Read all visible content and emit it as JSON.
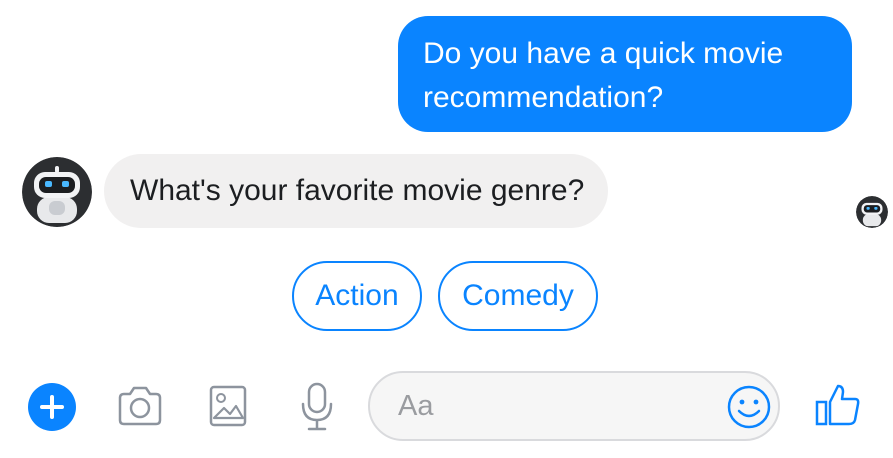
{
  "conversation": {
    "outgoing_message": "Do you have a quick movie recommendation?",
    "incoming_message": "What's your favorite movie genre?",
    "bot_avatar_icon": "robot-icon",
    "read_receipt_icon": "robot-icon"
  },
  "quick_replies": [
    {
      "label": "Action"
    },
    {
      "label": "Comedy"
    }
  ],
  "composer": {
    "placeholder": "Aa",
    "icons": [
      "plus-icon",
      "camera-icon",
      "photo-icon",
      "microphone-icon",
      "emoji-icon",
      "thumbs-up-icon"
    ]
  },
  "colors": {
    "accent": "#0a84ff",
    "incoming_bubble": "#f1f0f0",
    "icon_gray": "#8d949e"
  }
}
